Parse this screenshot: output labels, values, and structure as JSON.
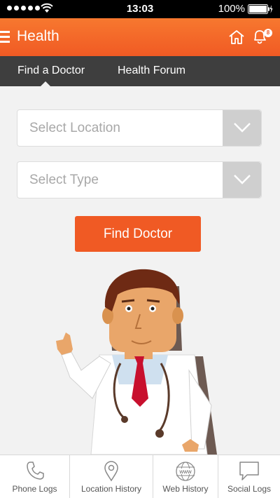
{
  "status_bar": {
    "time": "13:03",
    "battery": "100%"
  },
  "header": {
    "title": "Health",
    "notification_count": "8"
  },
  "tabs": [
    {
      "label": "Find a Doctor",
      "active": true
    },
    {
      "label": "Health Forum",
      "active": false
    }
  ],
  "form": {
    "location_placeholder": "Select Location",
    "type_placeholder": "Select Type",
    "submit_label": "Find Doctor"
  },
  "bottom_nav": [
    {
      "label": "Phone Logs",
      "icon": "phone-icon"
    },
    {
      "label": "Location History",
      "icon": "location-pin-icon"
    },
    {
      "label": "Web History",
      "icon": "globe-www-icon"
    },
    {
      "label": "Social Logs",
      "icon": "speech-bubble-icon"
    }
  ],
  "colors": {
    "accent": "#f05a24",
    "tab_bar": "#3e3e3e",
    "background": "#f2f2f2"
  }
}
